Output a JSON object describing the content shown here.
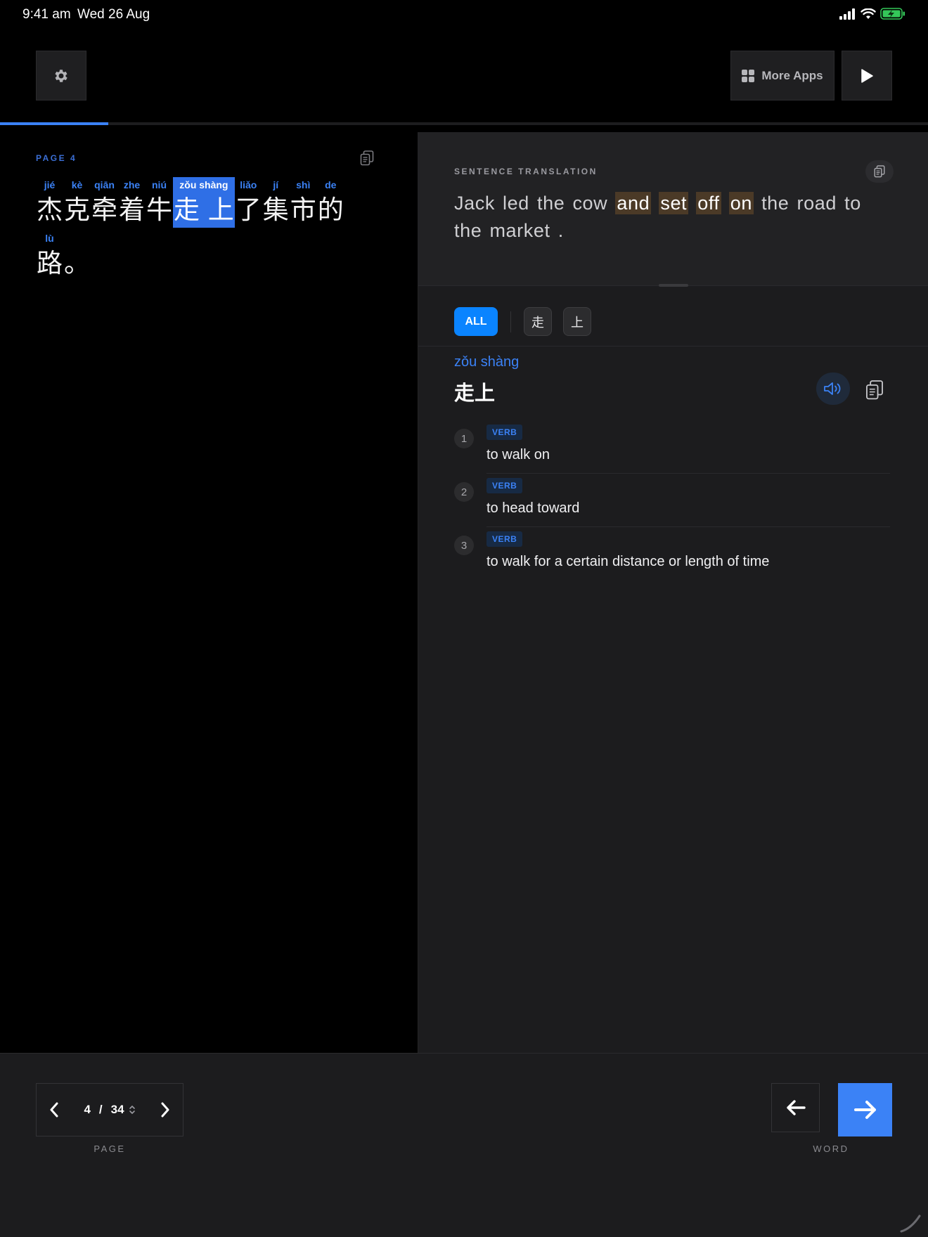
{
  "status": {
    "time": "9:41 am",
    "date": "Wed 26 Aug",
    "icons": [
      "signal-icon",
      "wifi-icon",
      "battery-charging-icon"
    ]
  },
  "topbar": {
    "settings_icon": "gear-icon",
    "more_apps_label": "More Apps",
    "more_apps_icon": "grid-icon",
    "play_icon": "play-icon",
    "progress_fraction": 0.117
  },
  "reader": {
    "page_label": "PAGE 4",
    "lines": [
      [
        {
          "pinyin": "jié",
          "hanzi": "杰",
          "selected": false
        },
        {
          "pinyin": "kè",
          "hanzi": "克",
          "selected": false
        },
        {
          "pinyin": "qiān",
          "hanzi": "牵",
          "selected": false
        },
        {
          "pinyin": "zhe",
          "hanzi": "着",
          "selected": false
        },
        {
          "pinyin": "niú",
          "hanzi": "牛",
          "selected": false
        },
        {
          "pinyin": "zǒu shàng",
          "hanzi": "走 上",
          "selected": true
        },
        {
          "pinyin": "liǎo",
          "hanzi": "了",
          "selected": false
        },
        {
          "pinyin": "jí",
          "hanzi": "集",
          "selected": false
        },
        {
          "pinyin": "shì",
          "hanzi": "市",
          "selected": false
        },
        {
          "pinyin": "de",
          "hanzi": "的",
          "selected": false
        }
      ],
      [
        {
          "pinyin": "lù",
          "hanzi": "路",
          "selected": false
        },
        {
          "pinyin": "",
          "hanzi": "。",
          "selected": false
        }
      ]
    ]
  },
  "translation": {
    "label": "SENTENCE TRANSLATION",
    "words": [
      {
        "text": "Jack",
        "hl": false
      },
      {
        "text": "led",
        "hl": false
      },
      {
        "text": "the",
        "hl": false
      },
      {
        "text": "cow",
        "hl": false
      },
      {
        "text": "and",
        "hl": true
      },
      {
        "text": "set",
        "hl": true
      },
      {
        "text": "off",
        "hl": true
      },
      {
        "text": "on",
        "hl": true
      },
      {
        "text": "the",
        "hl": false
      },
      {
        "text": "road",
        "hl": false
      },
      {
        "text": "to",
        "hl": false
      },
      {
        "text": "the",
        "hl": false
      },
      {
        "text": "market",
        "hl": false
      },
      {
        "text": ".",
        "hl": false
      }
    ]
  },
  "filters": {
    "all_label": "ALL",
    "chars": [
      "走",
      "上"
    ]
  },
  "word": {
    "pinyin": "zǒu shàng",
    "hanzi": "走上",
    "definitions": [
      {
        "num": "1",
        "pos": "VERB",
        "text": "to walk on"
      },
      {
        "num": "2",
        "pos": "VERB",
        "text": "to head toward"
      },
      {
        "num": "3",
        "pos": "VERB",
        "text": "to walk for a certain distance or length of time"
      }
    ]
  },
  "pager": {
    "current": "4",
    "separator": "/",
    "total": "34",
    "caption": "PAGE"
  },
  "word_nav": {
    "caption": "WORD"
  },
  "colors": {
    "accent": "#3b82f6",
    "chip_active": "#0a84ff",
    "highlight": "#4b3a27"
  }
}
